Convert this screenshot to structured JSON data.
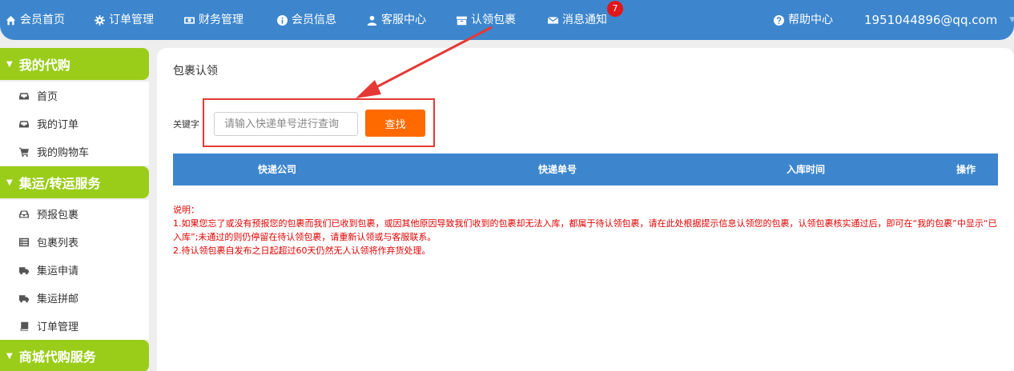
{
  "topnav": {
    "items": [
      {
        "label": "会员首页",
        "icon": "home-icon"
      },
      {
        "label": "订单管理",
        "icon": "gear-icon"
      },
      {
        "label": "财务管理",
        "icon": "money-icon"
      },
      {
        "label": "会员信息",
        "icon": "info-icon"
      },
      {
        "label": "客服中心",
        "icon": "user-icon"
      },
      {
        "label": "认领包裹",
        "icon": "package-icon"
      },
      {
        "label": "消息通知",
        "icon": "envelope-icon"
      }
    ],
    "badge": "7",
    "help": "帮助中心",
    "account": "1951044896@qq.com"
  },
  "sidebar": {
    "sections": [
      {
        "label": "我的代购",
        "items": [
          {
            "label": "首页",
            "icon": "inbox-icon"
          },
          {
            "label": "我的订单",
            "icon": "inbox-icon"
          },
          {
            "label": "我的购物车",
            "icon": "cart-icon"
          }
        ]
      },
      {
        "label": "集运/转运服务",
        "items": [
          {
            "label": "预报包裹",
            "icon": "tray-icon"
          },
          {
            "label": "包裹列表",
            "icon": "list-icon"
          },
          {
            "label": "集运申请",
            "icon": "truck-icon"
          },
          {
            "label": "集运拼邮",
            "icon": "truck-icon"
          },
          {
            "label": "订单管理",
            "icon": "book-icon"
          }
        ]
      },
      {
        "label": "商城代购服务",
        "items": []
      }
    ]
  },
  "main": {
    "title": "包裹认领",
    "keyword_label": "关键字",
    "search_placeholder": "请输入快递单号进行查询",
    "search_button": "查找",
    "table_headers": [
      "快递公司",
      "快递单号",
      "入库时间",
      "操作"
    ],
    "notes": [
      "说明：",
      "1.如果您忘了或没有预报您的包裹而我们已收到包裹，或因其他原因导致我们收到的包裹却无法入库，都属于待认领包裹，请在此处根据提示信息认领您的包裹，认领包裹核实通过后，即可在“我的包裹”中显示“已入库”;未通过的则仍停留在待认领包裹，请重新认领或与客服联系。",
      "2.待认领包裹自发布之日起超过60天仍然无人认领将作弃货处理。"
    ]
  },
  "colors": {
    "nav_blue": "#3d86cd",
    "sidebar_green": "#9acd1a",
    "button_orange": "#ff6a00",
    "note_red": "#e10000",
    "annotation_red": "#e53935"
  }
}
